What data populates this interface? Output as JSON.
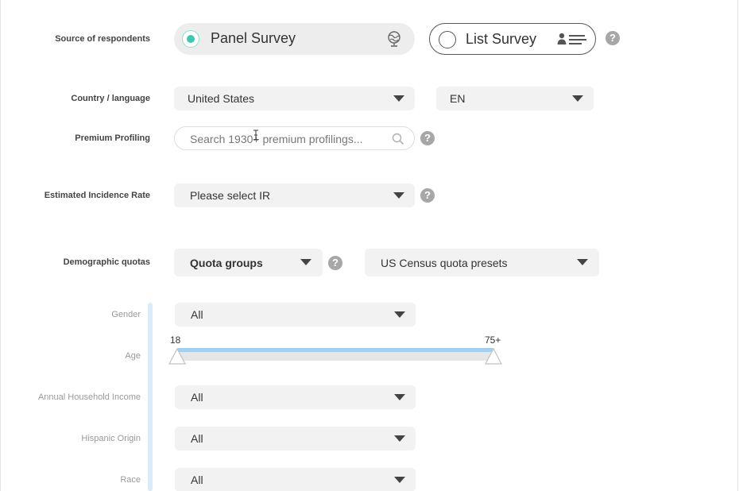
{
  "source": {
    "label": "Source of respondents",
    "panel_label": "Panel Survey",
    "panel_selected": true,
    "list_label": "List Survey",
    "list_selected": false,
    "help": "?"
  },
  "country": {
    "label": "Country / language",
    "country_value": "United States",
    "language_value": "EN"
  },
  "profiling": {
    "label": "Premium Profiling",
    "placeholder": "Search 1930+ premium profilings...",
    "help": "?"
  },
  "incidence": {
    "label": "Estimated Incidence Rate",
    "value": "Please select IR",
    "help": "?"
  },
  "quotas": {
    "label": "Demographic quotas",
    "groups_value": "Quota groups",
    "presets_value": "US Census quota presets",
    "help": "?"
  },
  "demographics": {
    "gender": {
      "label": "Gender",
      "value": "All"
    },
    "age": {
      "label": "Age",
      "min_label": "18",
      "max_label": "75+",
      "range_min_fraction": 0.0,
      "range_max_fraction": 1.0
    },
    "income": {
      "label": "Annual Household Income",
      "value": "All"
    },
    "hispanic": {
      "label": "Hispanic Origin",
      "value": "All"
    },
    "race": {
      "label": "Race",
      "value": "All"
    }
  },
  "colors": {
    "accent_teal": "#3fc7b4",
    "slider_blue": "#a4cfee",
    "field_gray": "#f2f2f2",
    "help_gray": "#a7a7a7"
  },
  "icons": {
    "panel": "globe-icon",
    "list": "contact-list-icon",
    "search": "search-icon",
    "caret": "chevron-down-icon",
    "help": "help-icon"
  }
}
